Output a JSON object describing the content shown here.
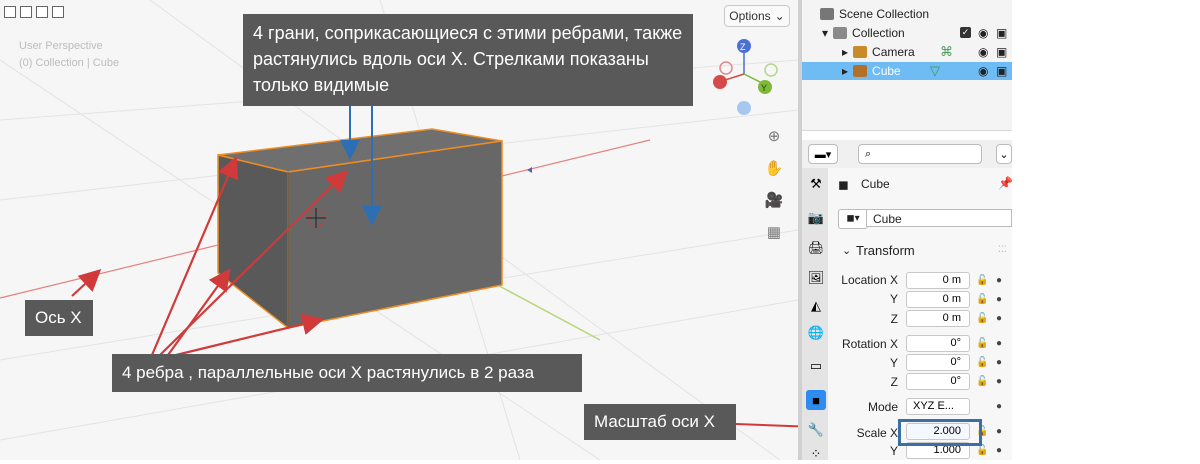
{
  "viewport": {
    "hud_line1": "User Perspective",
    "hud_line2": "(0) Collection | Cube",
    "options_label": "Options",
    "options_arrow": "⌄",
    "gizmo": {
      "z": "Z",
      "y": "Y"
    },
    "nav_icons": [
      "zoom-icon",
      "hand-icon",
      "camera-icon",
      "grid-icon"
    ]
  },
  "callouts": {
    "faces": "4 грани,  соприкасающиеся с этими ребрами,  также растянулись вдоль оси X. Стрелками показаны только видимые",
    "axis": "Ось Х",
    "edges": "4 ребра  , параллельные оси Х  растянулись в 2 раза",
    "scale": "Масштаб оси Х"
  },
  "outliner": {
    "scene_collection": "Scene Collection",
    "collection": "Collection",
    "camera": "Camera",
    "cube": "Cube",
    "arrow_right": "▸",
    "arrow_down": "▾"
  },
  "properties": {
    "object_name": "Cube",
    "mesh_name": "Cube",
    "transform_label": "Transform",
    "location_x_label": "Location X",
    "y_label": "Y",
    "z_label": "Z",
    "rotation_x_label": "Rotation X",
    "mode_label": "Mode",
    "scale_label": "Scale X",
    "location": [
      "0 m",
      "0 m",
      "0 m"
    ],
    "rotation": [
      "0°",
      "0°",
      "0°"
    ],
    "mode_value": "XYZ E...",
    "scale": [
      "2.000",
      "1.000"
    ]
  },
  "colors": {
    "callout_bg": "#595959",
    "arrow_red": "#d03a3a",
    "selection_orange": "#f08c24",
    "axis_x_red": "#e58080",
    "axis_y_green": "#b6d67a",
    "selected_row": "#6fbcf5",
    "highlight_box": "#3b6fa8"
  }
}
